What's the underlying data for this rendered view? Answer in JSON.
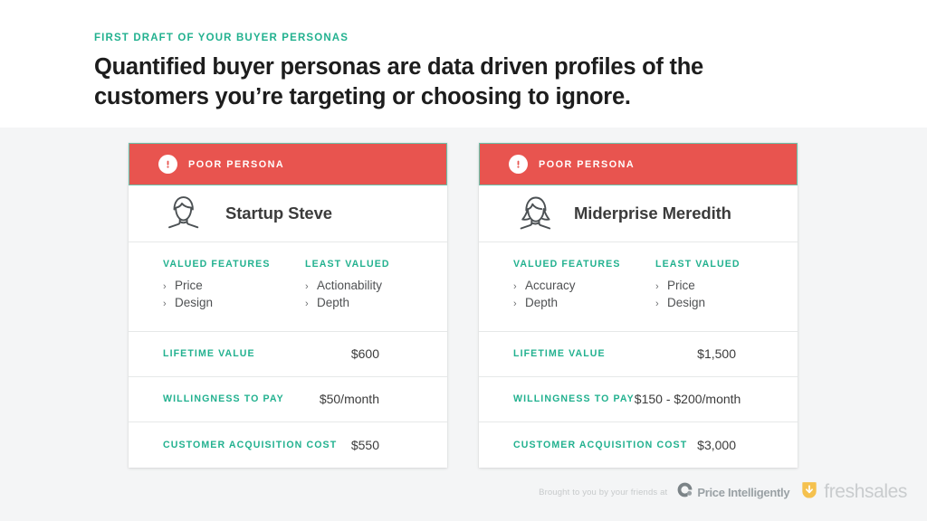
{
  "header": {
    "kicker": "FIRST DRAFT OF YOUR BUYER PERSONAS",
    "headline": "Quantified buyer personas are data driven profiles of the customers you’re targeting or choosing to ignore."
  },
  "colors": {
    "accent_teal": "#22b18f",
    "banner_red": "#e8544f",
    "banner_border": "#6bbfa8",
    "page_bg": "#f4f5f6",
    "card_bg": "#ffffff",
    "text_dark": "#3b3b3b",
    "footer_gray": "#c7cacb",
    "freshsales_yellow": "#f5c14e"
  },
  "cards": [
    {
      "banner_label": "POOR PERSONA",
      "banner_icon": "alert-exclamation-icon",
      "avatar_icon": "male-avatar-icon",
      "persona_name": "Startup Steve",
      "valued": {
        "title": "VALUED FEATURES",
        "items": [
          "Price",
          "Design"
        ]
      },
      "least_valued": {
        "title": "LEAST VALUED",
        "items": [
          "Actionability",
          "Depth"
        ]
      },
      "metrics": [
        {
          "label": "LIFETIME VALUE",
          "value": "$600"
        },
        {
          "label": "WILLINGNESS TO PAY",
          "value": "$50/month"
        },
        {
          "label": "CUSTOMER ACQUISITION COST",
          "value": "$550"
        }
      ]
    },
    {
      "banner_label": "POOR PERSONA",
      "banner_icon": "alert-exclamation-icon",
      "avatar_icon": "female-avatar-icon",
      "persona_name": "Miderprise Meredith",
      "valued": {
        "title": "VALUED FEATURES",
        "items": [
          "Accuracy",
          "Depth"
        ]
      },
      "least_valued": {
        "title": "LEAST VALUED",
        "items": [
          "Price",
          "Design"
        ]
      },
      "metrics": [
        {
          "label": "LIFETIME VALUE",
          "value": "$1,500"
        },
        {
          "label": "WILLINGNESS TO PAY",
          "value": "$150 - $200/month"
        },
        {
          "label": "CUSTOMER ACQUISITION COST",
          "value": "$3,000"
        }
      ]
    }
  ],
  "bullet_glyph": "›",
  "footer": {
    "text": "Brought to you by your friends at",
    "price_intelligently": "Price Intelligently",
    "freshsales": "freshsales"
  }
}
